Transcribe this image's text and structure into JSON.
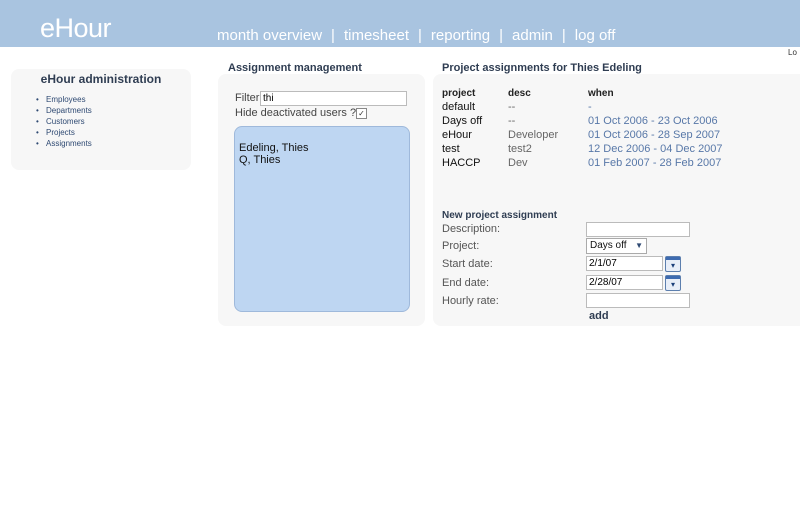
{
  "app": {
    "logo": "eHour"
  },
  "nav": {
    "items": [
      "month overview",
      "timesheet",
      "reporting",
      "admin",
      "log off"
    ],
    "separator": "|"
  },
  "login_cut": "Lo",
  "admin_menu": {
    "title": "eHour administration",
    "items": [
      "Employees",
      "Departments",
      "Customers",
      "Projects",
      "Assignments"
    ]
  },
  "assignment_mgmt": {
    "title": "Assignment management",
    "filter_label": "Filter:",
    "filter_value": "thi",
    "hide_deactivated_label": "Hide deactivated users ?:",
    "hide_deactivated_checked": true,
    "users": [
      "Edeling, Thies",
      "Q, Thies"
    ]
  },
  "project_assignments": {
    "title": "Project assignments for Thies Edeling",
    "columns": [
      "project",
      "desc",
      "when"
    ],
    "rows": [
      [
        "default",
        "--",
        "-"
      ],
      [
        "Days off",
        "--",
        "01 Oct 2006 - 23 Oct 2006"
      ],
      [
        "eHour",
        "Developer",
        "01 Oct 2006 - 28 Sep 2007"
      ],
      [
        "test",
        "test2",
        "12 Dec 2006 - 04 Dec 2007"
      ],
      [
        "HACCP",
        "Dev",
        "01 Feb 2007 - 28 Feb 2007"
      ]
    ]
  },
  "new_assignment": {
    "title": "New project assignment",
    "description_label": "Description:",
    "description_value": "",
    "project_label": "Project:",
    "project_value": "Days off",
    "start_label": "Start date:",
    "start_value": "2/1/07",
    "end_label": "End date:",
    "end_value": "2/28/07",
    "rate_label": "Hourly rate:",
    "rate_value": "",
    "add_label": "add"
  },
  "icons": {
    "calendar": "calendar-icon",
    "dropdown": "chevron-down-icon",
    "check": "checkmark-icon"
  }
}
